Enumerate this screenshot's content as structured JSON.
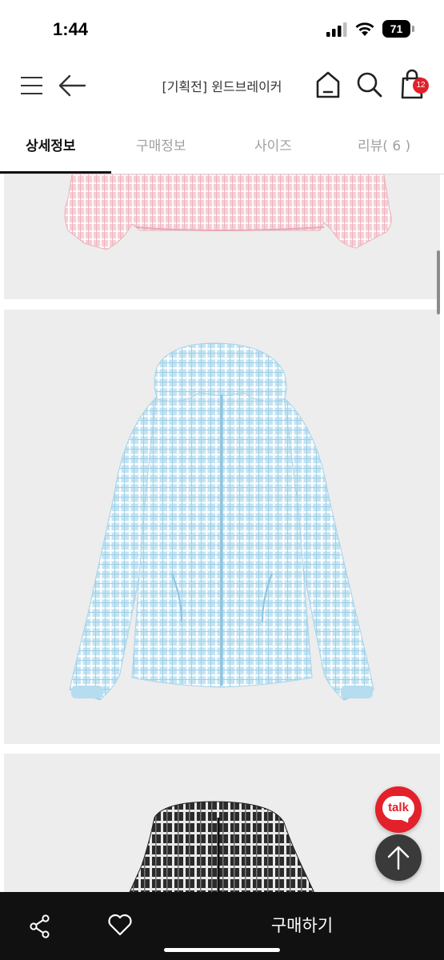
{
  "status": {
    "time": "1:44",
    "battery": "71"
  },
  "header": {
    "title": "[기획전] 윈드브레이커",
    "cart_count": "12",
    "icons": [
      "hamburger-menu-icon",
      "back-arrow-icon",
      "home-icon",
      "search-icon",
      "shopping-bag-icon"
    ]
  },
  "tabs": [
    {
      "label": "상세정보",
      "active": true
    },
    {
      "label": "구매정보",
      "active": false
    },
    {
      "label": "사이즈",
      "active": false
    },
    {
      "label": "리뷰( 6 )",
      "active": false
    }
  ],
  "floating": {
    "talk_label": "talk",
    "talk_color": "#e3212b",
    "top_icon": "arrow-up-icon"
  },
  "bottom_bar": {
    "buy_label": "구매하기",
    "icons": [
      "share-icon",
      "heart-icon"
    ]
  },
  "colors": {
    "accent": "#e2202a",
    "bottom_bar": "#111111",
    "pink_jacket": "#f5c9d2",
    "blue_jacket": "#bfe2f2",
    "black_jacket": "#2b2b2b"
  }
}
